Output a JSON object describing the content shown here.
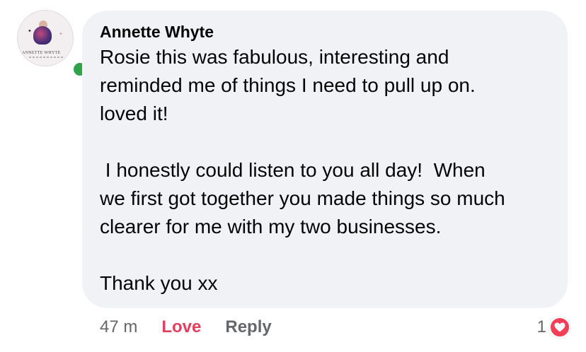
{
  "comment": {
    "author": "Annette Whyte",
    "avatar_text": "ANNETTE WHYTE",
    "paragraphs": [
      "Rosie this was fabulous, interesting and",
      "reminded me of things I need to pull up on.",
      "loved it!",
      "",
      " I honestly could listen to you all day!  When",
      "we first got together you made things so much",
      "clearer for me with my two businesses.",
      "",
      "Thank you xx"
    ],
    "online_status": "online",
    "status_color": "#31a24c",
    "bubble_color": "#f0f2f5"
  },
  "actions": {
    "timestamp": "47 m",
    "love_label": "Love",
    "love_color": "#e3405e",
    "reply_label": "Reply"
  },
  "reactions": {
    "count": "1",
    "type_icon": "heart-icon",
    "color": "#f33e58"
  }
}
